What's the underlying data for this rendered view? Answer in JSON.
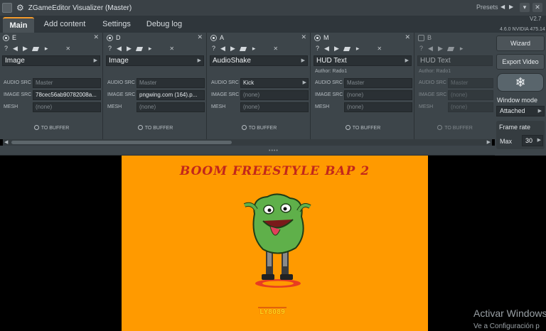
{
  "window": {
    "title": "ZGameEditor Visualizer (Master)",
    "presets_label": "Presets",
    "version": "V2.7",
    "gpu_info": "4.6.0 NVIDIA 475.14"
  },
  "tabs": [
    {
      "label": "Main",
      "active": true
    },
    {
      "label": "Add content",
      "active": false
    },
    {
      "label": "Settings",
      "active": false
    },
    {
      "label": "Debug log",
      "active": false
    }
  ],
  "layers": [
    {
      "id": "E",
      "enabled": true,
      "type": "Image",
      "author": "",
      "audio_src": {
        "value": "Master",
        "is_placeholder": true
      },
      "image_src": {
        "value": "78cec56ab90782008a...",
        "is_placeholder": false
      },
      "mesh": {
        "value": "(none)",
        "is_placeholder": true
      },
      "buffer": "TO BUFFER"
    },
    {
      "id": "D",
      "enabled": true,
      "type": "Image",
      "author": "",
      "audio_src": {
        "value": "Master",
        "is_placeholder": true
      },
      "image_src": {
        "value": "pngwing.com (164).p...",
        "is_placeholder": false
      },
      "mesh": {
        "value": "(none)",
        "is_placeholder": true
      },
      "buffer": "TO BUFFER"
    },
    {
      "id": "A",
      "enabled": true,
      "type": "AudioShake",
      "author": "",
      "audio_src": {
        "value": "Kick",
        "is_placeholder": false
      },
      "image_src": {
        "value": "(none)",
        "is_placeholder": true
      },
      "mesh": {
        "value": "(none)",
        "is_placeholder": true
      },
      "buffer": "TO BUFFER"
    },
    {
      "id": "M",
      "enabled": true,
      "type": "HUD Text",
      "author": "Author: Rado1",
      "audio_src": {
        "value": "Master",
        "is_placeholder": true
      },
      "image_src": {
        "value": "(none)",
        "is_placeholder": true
      },
      "mesh": {
        "value": "(none)",
        "is_placeholder": true
      },
      "buffer": "TO BUFFER"
    },
    {
      "id": "B",
      "enabled": false,
      "type": "HUD Text",
      "author": "Author: Rado1",
      "audio_src": {
        "value": "Master",
        "is_placeholder": true
      },
      "image_src": {
        "value": "(none)",
        "is_placeholder": true
      },
      "mesh": {
        "value": "(none)",
        "is_placeholder": true
      },
      "buffer": "TO BUFFER"
    }
  ],
  "labels": {
    "audio_src": "AUDIO SRC",
    "image_src": "IMAGE SRC",
    "mesh": "MESH"
  },
  "right_panel": {
    "wizard": "Wizard",
    "export_video": "Export Video",
    "window_mode_label": "Window mode",
    "window_mode_value": "Attached",
    "frame_rate_label": "Frame rate",
    "frame_rate_mode": "Max",
    "frame_rate_value": "30"
  },
  "preview": {
    "cover_title": "BOOM FREESTYLE BAP 2",
    "brand": "LY8089",
    "watermark_line1": "Activar Windows",
    "watermark_line2": "Ve a Configuración p"
  },
  "colors": {
    "accent": "#f39a2b",
    "canvas_bg": "#ff9a00",
    "cover_title": "#c2271b"
  }
}
